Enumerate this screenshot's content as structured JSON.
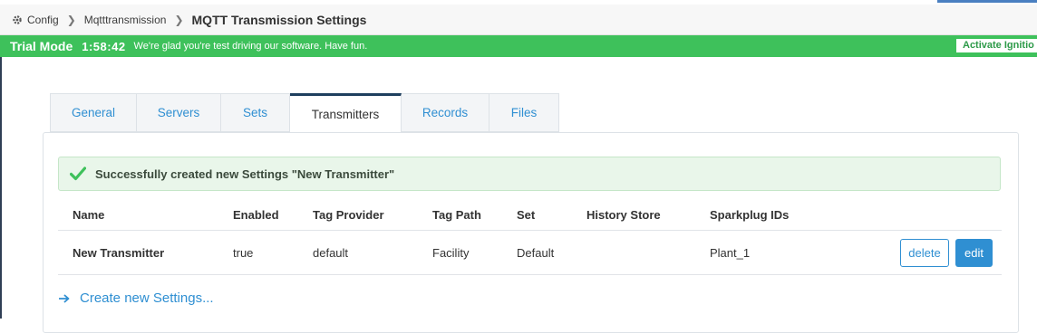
{
  "breadcrumb": {
    "icon": "gear-icon",
    "items": [
      "Config",
      "Mqtttransmission"
    ],
    "title": "MQTT Transmission Settings"
  },
  "trial": {
    "mode": "Trial Mode",
    "time": "1:58:42",
    "message": "We're glad you're test driving our software. Have fun.",
    "activate": "Activate Ignitio",
    "color": "#3ec15b"
  },
  "tabs": [
    "General",
    "Servers",
    "Sets",
    "Transmitters",
    "Records",
    "Files"
  ],
  "active_tab": "Transmitters",
  "alert": {
    "icon": "check-icon",
    "text": "Successfully created new Settings \"New Transmitter\""
  },
  "table": {
    "columns": [
      "Name",
      "Enabled",
      "Tag Provider",
      "Tag Path",
      "Set",
      "History Store",
      "Sparkplug IDs"
    ],
    "rows": [
      {
        "name": "New Transmitter",
        "enabled": "true",
        "tag_provider": "default",
        "tag_path": "Facility",
        "set": "Default",
        "history_store": "",
        "sparkplug_ids": "Plant_1",
        "delete_label": "delete",
        "edit_label": "edit"
      }
    ]
  },
  "create_link": {
    "icon": "arrow-right-icon",
    "label": "Create new Settings..."
  },
  "colors": {
    "accent": "#2f8fd2",
    "success_bg": "#e9f6ea"
  }
}
